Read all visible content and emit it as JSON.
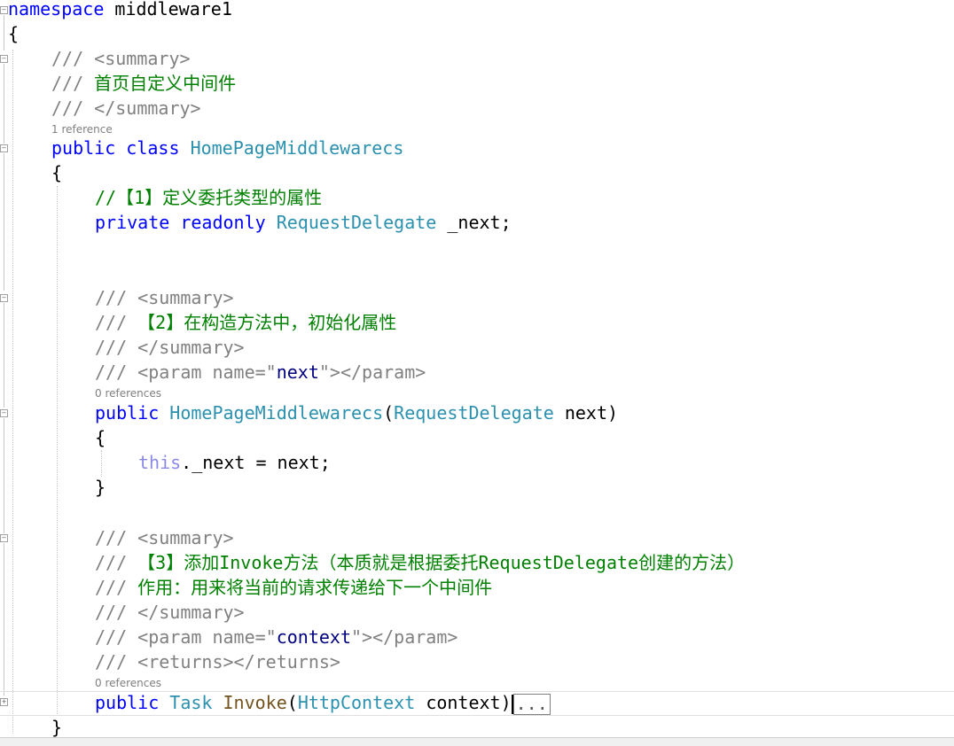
{
  "code": {
    "namespace_kw": "namespace",
    "namespace_name": "middleware1",
    "brace_open": "{",
    "brace_close": "}",
    "class_summary_open": "/// <summary>",
    "class_summary_text_prefix": "/// ",
    "class_summary_text": "首页自定义中间件",
    "class_summary_close": "/// </summary>",
    "class_refs": "1 reference",
    "kw_public": "public",
    "kw_class": "class",
    "class_name": "HomePageMiddlewarecs",
    "field_comment": "//【1】定义委托类型的属性",
    "kw_private": "private",
    "kw_readonly": "readonly",
    "type_request_delegate": "RequestDelegate",
    "field_name": "_next;",
    "ctor_summary_open": "/// <summary>",
    "ctor_summary_prefix": "/// ",
    "ctor_summary_text": "【2】在构造方法中，初始化属性",
    "ctor_summary_close": "/// </summary>",
    "ctor_param_open": "/// <param name=\"",
    "ctor_param_name": "next",
    "ctor_param_close": "\"></param>",
    "ctor_refs": "0 references",
    "ctor_open_paren": "(",
    "ctor_param_var": "next)",
    "kw_this": "this",
    "assign_stmt": "._next = next;",
    "inv_summary_open": "/// <summary>",
    "inv_summary_prefix": "/// ",
    "inv_summary_text1": "【3】添加Invoke方法（本质就是根据委托RequestDelegate创建的方法）",
    "inv_summary_text2": "作用：用来将当前的请求传递给下一个中间件",
    "inv_summary_close": "/// </summary>",
    "inv_param_open": "/// <param name=\"",
    "inv_param_name": "context",
    "inv_param_close": "\"></param>",
    "inv_returns": "/// <returns></returns>",
    "inv_refs": "0 references",
    "type_task": "Task",
    "method_invoke": "Invoke",
    "type_httpcontext": "HttpContext",
    "invoke_param": "context)",
    "collapsed_marker": "..."
  },
  "fold_glyphs": {
    "expanded": "−",
    "collapsed": "+"
  }
}
